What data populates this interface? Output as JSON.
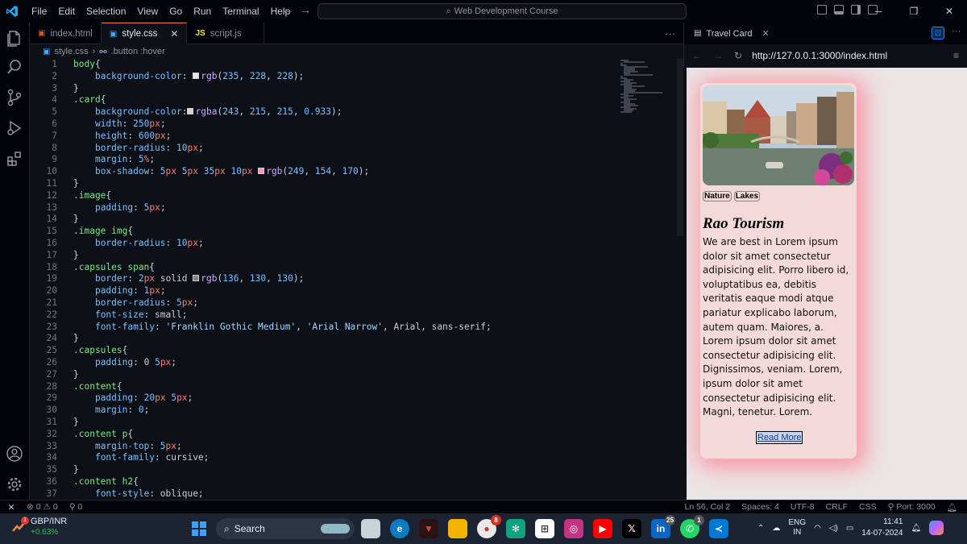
{
  "titlebar": {
    "menu": [
      "File",
      "Edit",
      "Selection",
      "View",
      "Go",
      "Run",
      "Terminal",
      "Help"
    ],
    "command_center": "Web Development Course"
  },
  "tabs": [
    {
      "icon": "html-icon",
      "label": "index.html"
    },
    {
      "icon": "css-icon",
      "label": "style.css"
    },
    {
      "icon": "js-icon",
      "label": "script.js"
    }
  ],
  "breadcrumb": {
    "file": "style.css",
    "symbol": ".button :hover"
  },
  "editor": {
    "lines": [
      {
        "n": "1",
        "t": "body{"
      },
      {
        "n": "2",
        "t": "    background-color: rgb(235, 228, 228);"
      },
      {
        "n": "3",
        "t": "}"
      },
      {
        "n": "4",
        "t": ".card{"
      },
      {
        "n": "5",
        "t": "    background-color:rgba(243, 215, 215, 0.933);"
      },
      {
        "n": "6",
        "t": "    width: 250px;"
      },
      {
        "n": "7",
        "t": "    height: 600px;"
      },
      {
        "n": "8",
        "t": "    border-radius: 10px;"
      },
      {
        "n": "9",
        "t": "    margin: 5%;"
      },
      {
        "n": "10",
        "t": "    box-shadow: 5px 5px 35px 10px rgb(249, 154, 170);"
      },
      {
        "n": "11",
        "t": "}"
      },
      {
        "n": "12",
        "t": ".image{"
      },
      {
        "n": "13",
        "t": "    padding: 5px;"
      },
      {
        "n": "14",
        "t": "}"
      },
      {
        "n": "15",
        "t": ".image img{"
      },
      {
        "n": "16",
        "t": "    border-radius: 10px;"
      },
      {
        "n": "17",
        "t": "}"
      },
      {
        "n": "18",
        "t": ".capsules span{"
      },
      {
        "n": "19",
        "t": "    border: 2px solid rgb(136, 130, 130);"
      },
      {
        "n": "20",
        "t": "    padding: 1px;"
      },
      {
        "n": "21",
        "t": "    border-radius: 5px;"
      },
      {
        "n": "22",
        "t": "    font-size: small;"
      },
      {
        "n": "23",
        "t": "    font-family: 'Franklin Gothic Medium', 'Arial Narrow', Arial, sans-serif;"
      },
      {
        "n": "24",
        "t": "}"
      },
      {
        "n": "25",
        "t": ".capsules{"
      },
      {
        "n": "26",
        "t": "    padding: 0 5px;"
      },
      {
        "n": "27",
        "t": "}"
      },
      {
        "n": "28",
        "t": ".content{"
      },
      {
        "n": "29",
        "t": "    padding: 20px 5px;"
      },
      {
        "n": "30",
        "t": "    margin: 0;"
      },
      {
        "n": "31",
        "t": "}"
      },
      {
        "n": "32",
        "t": ".content p{"
      },
      {
        "n": "33",
        "t": "    margin-top: 5px;"
      },
      {
        "n": "34",
        "t": "    font-family: cursive;"
      },
      {
        "n": "35",
        "t": "}"
      },
      {
        "n": "36",
        "t": ".content h2{"
      },
      {
        "n": "37",
        "t": "    font-style: oblique;"
      }
    ]
  },
  "preview": {
    "tab_title": "Travel Card",
    "url": "http://127.0.0.1:3000/index.html",
    "card": {
      "tags": [
        "Nature",
        "Lakes"
      ],
      "title": "Rao Tourism",
      "body": "We are best in Lorem ipsum dolor sit amet consectetur adipisicing elit. Porro libero id, voluptatibus ea, debitis veritatis eaque modi atque pariatur explicabo laborum, autem quam. Maiores, a. Lorem ipsum dolor sit amet consectetur adipisicing elit. Dignissimos, veniam. Lorem, ipsum dolor sit amet consectetur adipisicing elit. Magni, tenetur. Lorem.",
      "button": "Read More"
    }
  },
  "status": {
    "errors": "0",
    "warnings": "0",
    "ports": "0",
    "cursor": "Ln 56, Col 2",
    "spaces": "Spaces: 4",
    "encoding": "UTF-8",
    "eol": "CRLF",
    "language": "CSS",
    "port": "Port: 3000"
  },
  "taskbar": {
    "ticker": "GBP/INR",
    "ticker_change": "+0.63%",
    "ticker_badge": "1",
    "search_placeholder": "Search",
    "badge_chrome": "8",
    "badge_linkedin": "25",
    "badge_whatsapp": "1",
    "lang_top": "ENG",
    "lang_bottom": "IN",
    "time": "11:41",
    "date": "14-07-2024"
  },
  "colors": {
    "accent": "#f78166",
    "card_bg": "#f3d7d7",
    "card_shadow": "#f99aaa"
  }
}
